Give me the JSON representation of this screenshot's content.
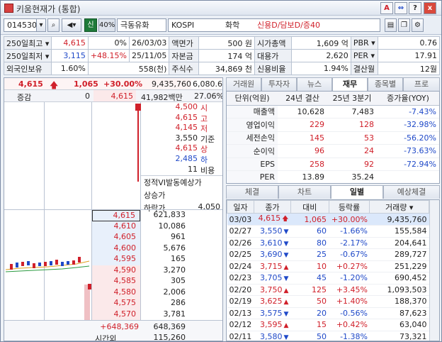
{
  "window": {
    "title": "키움현재가 (통합)"
  },
  "title_buttons": [
    "A",
    "?",
    "x"
  ],
  "toolbar": {
    "code": "014530",
    "credit_badge": "신",
    "margin_badge": "40%",
    "name": "극동유화",
    "market": "KOSPI",
    "sector": "화학",
    "credit_info": "신용D/담보D/증40"
  },
  "info": {
    "r1": {
      "l1": "250일최고",
      "v1": "4,615",
      "p1": "0%",
      "d1": "26/03/03",
      "l2": "액면가",
      "v2": "500 원",
      "l3": "시가총액",
      "v3": "1,609 억",
      "l4": "PBR",
      "v4": "0.76"
    },
    "r2": {
      "l1": "250일최저",
      "v1": "3,115",
      "p1": "+48.15%",
      "d1": "25/11/05",
      "l2": "자본금",
      "v2": "174 억",
      "l3": "대용가",
      "v3": "2,620",
      "l4": "PER",
      "v4": "17.91"
    },
    "r3": {
      "l1": "외국인보유",
      "v1": "1.60%",
      "d1": "558(천)",
      "l2": "주식수",
      "v2": "34,869 천",
      "l3": "신용비율",
      "v3": "1.94%",
      "l4": "결산월",
      "v4": "12월"
    }
  },
  "price_bar": {
    "price": "4,615",
    "change": "1,065",
    "rate": "+30.00%",
    "volume": "9,435,760",
    "turnover_short": "6,080.6"
  },
  "orderbook": {
    "header": {
      "label": "증감",
      "left": "0",
      "price": "4,615",
      "amount": "41,982백만",
      "rate": "27.06%"
    },
    "stats": [
      {
        "value": "4,500",
        "label": "시",
        "color": "#d0202a"
      },
      {
        "value": "4,615",
        "label": "고",
        "color": "#d0202a"
      },
      {
        "value": "4,145",
        "label": "저",
        "color": "#d0202a"
      },
      {
        "value": "3,550",
        "label": "기준",
        "color": "#222222"
      },
      {
        "value": "4,615",
        "label": "상",
        "color": "#d0202a"
      },
      {
        "value": "2,485",
        "label": "하",
        "color": "#1f49c8"
      },
      {
        "value": "11",
        "label": "비용",
        "color": "#222222"
      }
    ],
    "vi": {
      "label": "정적VI발동예상가",
      "up_label": "상승가",
      "down_label": "하락가",
      "down_value": "4,050"
    },
    "asks": [
      {
        "price": "4,615",
        "qty": "621,833"
      },
      {
        "price": "4,610",
        "qty": "10,086"
      },
      {
        "price": "4,605",
        "qty": "961"
      },
      {
        "price": "4,600",
        "qty": "5,676"
      },
      {
        "price": "4,595",
        "qty": "165"
      }
    ],
    "bids": [
      {
        "price": "4,590",
        "qty": "3,270"
      },
      {
        "price": "4,585",
        "qty": "305"
      },
      {
        "price": "4,580",
        "qty": "2,006"
      },
      {
        "price": "4,575",
        "qty": "286"
      },
      {
        "price": "4,570",
        "qty": "3,781"
      }
    ],
    "footer": {
      "diff": "+648,369",
      "total": "648,369",
      "after_hours_label": "시간외",
      "after_hours_value": "115,260"
    }
  },
  "top_tabs": [
    "거래원",
    "투자자",
    "뉴스",
    "재무",
    "종목별",
    "프로"
  ],
  "financials": {
    "headers": [
      "단위(억원)",
      "24년 결산",
      "25년 3분기",
      "증가율(YOY)"
    ],
    "rows": [
      {
        "label": "매출액",
        "a": "10,628",
        "b": "7,483",
        "yoy": "-7.43%",
        "ca": "#222222",
        "cb": "#222222",
        "cy": "#1f49c8"
      },
      {
        "label": "영업이익",
        "a": "229",
        "b": "128",
        "yoy": "-32.98%",
        "ca": "#d0202a",
        "cb": "#d0202a",
        "cy": "#1f49c8"
      },
      {
        "label": "세전손익",
        "a": "145",
        "b": "53",
        "yoy": "-56.20%",
        "ca": "#d0202a",
        "cb": "#d0202a",
        "cy": "#1f49c8"
      },
      {
        "label": "순이익",
        "a": "96",
        "b": "24",
        "yoy": "-73.63%",
        "ca": "#d0202a",
        "cb": "#d0202a",
        "cy": "#1f49c8"
      },
      {
        "label": "EPS",
        "a": "258",
        "b": "92",
        "yoy": "-72.94%",
        "ca": "#d0202a",
        "cb": "#d0202a",
        "cy": "#1f49c8"
      },
      {
        "label": "PER",
        "a": "13.89",
        "b": "35.24",
        "yoy": "",
        "ca": "#222222",
        "cb": "#222222",
        "cy": "#222222"
      }
    ]
  },
  "bottom_tabs": [
    "체결",
    "차트",
    "일별",
    "예상체결"
  ],
  "daily": {
    "headers": [
      "일자",
      "종가",
      "대비",
      "등락률",
      "거래량"
    ],
    "rows": [
      {
        "date": "03/03",
        "close": "4,615",
        "dir": "up-limit",
        "diff": "1,065",
        "rate": "+30.00%",
        "vol": "9,435,760"
      },
      {
        "date": "02/27",
        "close": "3,550",
        "dir": "down",
        "diff": "60",
        "rate": "-1.66%",
        "vol": "155,584"
      },
      {
        "date": "02/26",
        "close": "3,610",
        "dir": "down",
        "diff": "80",
        "rate": "-2.17%",
        "vol": "204,641"
      },
      {
        "date": "02/25",
        "close": "3,690",
        "dir": "down",
        "diff": "25",
        "rate": "-0.67%",
        "vol": "289,727"
      },
      {
        "date": "02/24",
        "close": "3,715",
        "dir": "up",
        "diff": "10",
        "rate": "+0.27%",
        "vol": "251,229"
      },
      {
        "date": "02/23",
        "close": "3,705",
        "dir": "down",
        "diff": "45",
        "rate": "-1.20%",
        "vol": "690,452"
      },
      {
        "date": "02/20",
        "close": "3,750",
        "dir": "up",
        "diff": "125",
        "rate": "+3.45%",
        "vol": "1,093,503"
      },
      {
        "date": "02/19",
        "close": "3,625",
        "dir": "up",
        "diff": "50",
        "rate": "+1.40%",
        "vol": "188,370"
      },
      {
        "date": "02/13",
        "close": "3,575",
        "dir": "down",
        "diff": "20",
        "rate": "-0.56%",
        "vol": "87,623"
      },
      {
        "date": "02/12",
        "close": "3,595",
        "dir": "up",
        "diff": "15",
        "rate": "+0.42%",
        "vol": "63,040"
      },
      {
        "date": "02/11",
        "close": "3,580",
        "dir": "down",
        "diff": "50",
        "rate": "-1.38%",
        "vol": "73,321"
      }
    ]
  },
  "colors": {
    "up": "#d0202a",
    "down": "#1f49c8",
    "ask_bg": "#e8f0fb",
    "bid_bg": "#fbe9ea"
  },
  "icons": [
    "window-icon",
    "search-icon",
    "speaker-icon",
    "page-icon",
    "copy-icon",
    "gear-icon",
    "pin-icon"
  ]
}
